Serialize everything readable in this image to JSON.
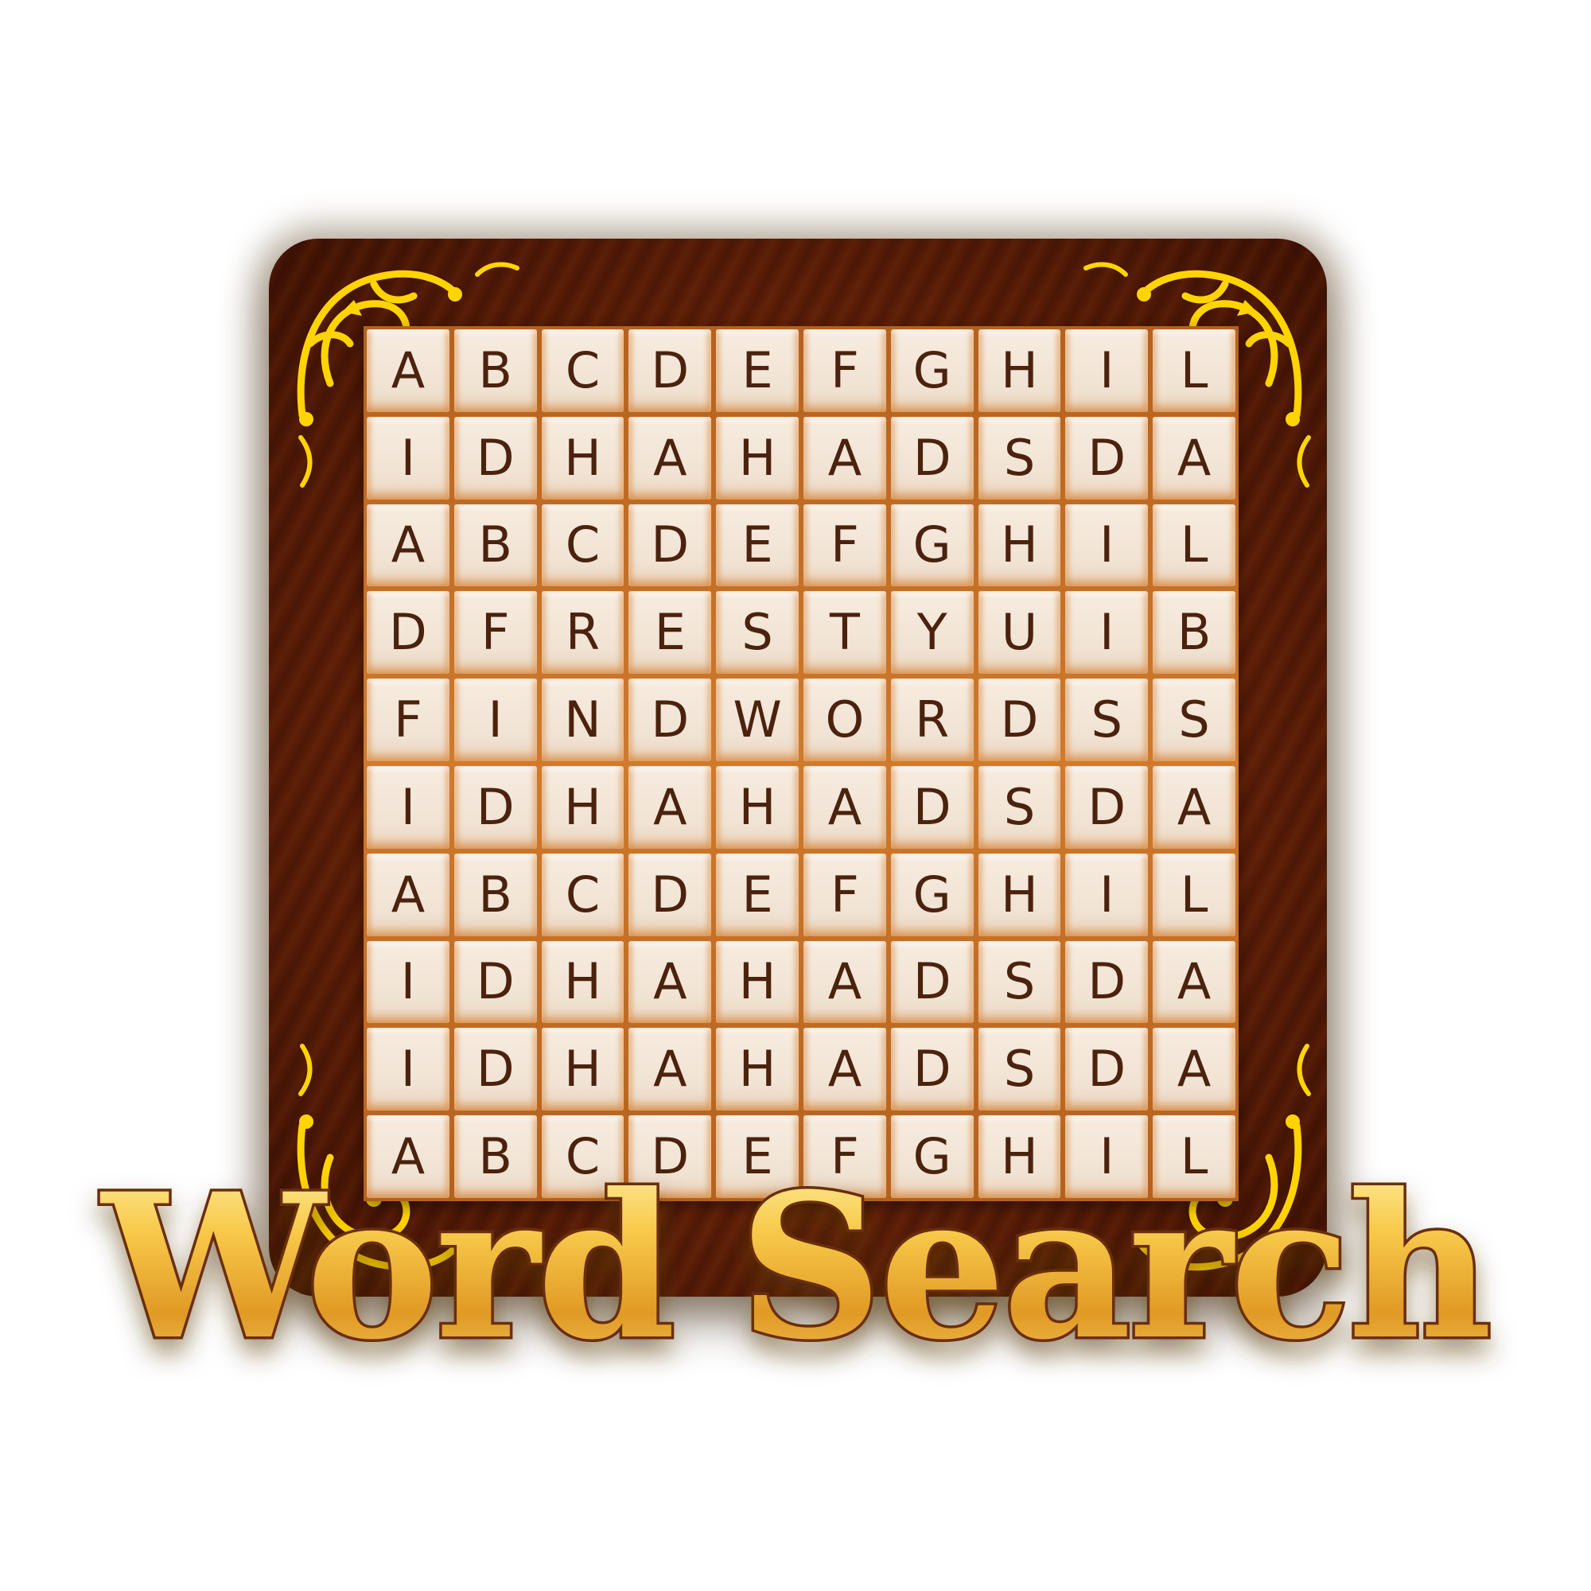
{
  "title": "Word Search",
  "grid": {
    "rows": [
      [
        "A",
        "B",
        "C",
        "D",
        "E",
        "F",
        "G",
        "H",
        "I",
        "L"
      ],
      [
        "I",
        "D",
        "H",
        "A",
        "H",
        "A",
        "D",
        "S",
        "D",
        "A"
      ],
      [
        "A",
        "B",
        "C",
        "D",
        "E",
        "F",
        "G",
        "H",
        "I",
        "L"
      ],
      [
        "D",
        "F",
        "R",
        "E",
        "S",
        "T",
        "Y",
        "U",
        "I",
        "B"
      ],
      [
        "F",
        "I",
        "N",
        "D",
        "W",
        "O",
        "R",
        "D",
        "S",
        "S"
      ],
      [
        "I",
        "D",
        "H",
        "A",
        "H",
        "A",
        "D",
        "S",
        "D",
        "A"
      ],
      [
        "A",
        "B",
        "C",
        "D",
        "E",
        "F",
        "G",
        "H",
        "I",
        "L"
      ],
      [
        "I",
        "D",
        "H",
        "A",
        "H",
        "A",
        "D",
        "S",
        "D",
        "A"
      ],
      [
        "I",
        "D",
        "H",
        "A",
        "H",
        "A",
        "D",
        "S",
        "D",
        "A"
      ],
      [
        "A",
        "B",
        "C",
        "D",
        "E",
        "F",
        "G",
        "H",
        "I",
        "L"
      ]
    ]
  },
  "colors": {
    "wood": "#5a1d07",
    "tile": "#f3e6d8",
    "tile_edge": "#d68030",
    "letter": "#4b220e",
    "ornament": "#ffd400",
    "title_gold": "#f2b53a",
    "title_outline": "#6b2e08"
  },
  "icons": [
    "corner-ornament-icon"
  ]
}
